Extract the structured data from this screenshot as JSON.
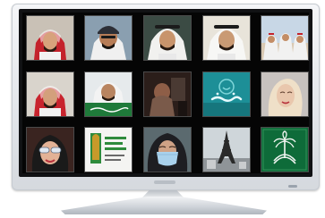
{
  "tiles": [
    {
      "id": "r1c1",
      "icon": "portrait-man-red-shemagh-icon",
      "colors": {
        "bg": "#c9c1b6",
        "cloth": "#c4222c",
        "face": "#d7a27c"
      }
    },
    {
      "id": "r1c2",
      "icon": "portrait-man-dark-cap-icon",
      "colors": {
        "bg": "#8a9fb0",
        "cloth": "#2d2f36",
        "face": "#b77d57"
      }
    },
    {
      "id": "r1c3",
      "icon": "portrait-man-white-ghutra-icon",
      "colors": {
        "bg": "#3b4b44",
        "cloth": "#f1f1ef",
        "face": "#c8946c"
      }
    },
    {
      "id": "r1c4",
      "icon": "portrait-man-white-ghutra-icon",
      "colors": {
        "bg": "#e8e4da",
        "cloth": "#f7f7f5",
        "face": "#c99a74"
      }
    },
    {
      "id": "r1c5",
      "icon": "group-photo-icon",
      "colors": {
        "bg": "#c8d7e6",
        "cloth": "#f1f1f1",
        "face": "#c38d66"
      }
    },
    {
      "id": "r2c1",
      "icon": "portrait-man-red-shemagh-icon",
      "colors": {
        "bg": "#d9d4cc",
        "cloth": "#c8242e",
        "face": "#d3a07c"
      }
    },
    {
      "id": "r2c2",
      "icon": "portrait-man-green-banner-icon",
      "colors": {
        "bg": "#e6eaec",
        "cloth": "#f3f3f3",
        "face": "#b88460",
        "accent": "#1f7a3a"
      }
    },
    {
      "id": "r2c3",
      "icon": "dark-scene-icon",
      "colors": {
        "bg": "#2b1e1a",
        "cloth": "#7a5a4a",
        "face": "#a06a50"
      }
    },
    {
      "id": "r2c4",
      "icon": "ibtisam-logo-icon",
      "colors": {
        "bg": "#1d8f97",
        "cloth": "#e7fbff",
        "face": "#7fd7da"
      }
    },
    {
      "id": "r2c5",
      "icon": "portrait-woman-blonde-icon",
      "colors": {
        "bg": "#c7c2bf",
        "cloth": "#efe0c8",
        "face": "#e9c7ad"
      }
    },
    {
      "id": "r3c1",
      "icon": "portrait-woman-sunglasses-icon",
      "colors": {
        "bg": "#3a2420",
        "cloth": "#1a1a1a",
        "face": "#e3b296",
        "accent": "#e0e8f2"
      }
    },
    {
      "id": "r3c2",
      "icon": "saudi-journalists-association-logo-icon",
      "colors": {
        "bg": "#f4f4f2",
        "cloth": "#2e8b3c",
        "face": "#c79a2a"
      }
    },
    {
      "id": "r3c3",
      "icon": "portrait-woman-face-mask-icon",
      "colors": {
        "bg": "#5b6a6f",
        "cloth": "#1e1e22",
        "face": "#cfa286",
        "accent": "#a9d1ec"
      }
    },
    {
      "id": "r3c4",
      "icon": "eiffel-tower-photo-icon",
      "colors": {
        "bg": "#cfd6da",
        "cloth": "#2a2a2a",
        "face": "#f2f2f2"
      }
    },
    {
      "id": "r3c5",
      "icon": "saudi-emblem-icon",
      "colors": {
        "bg": "#0e6b39",
        "cloth": "#f2f5f2",
        "face": "#0a5a2f"
      }
    }
  ]
}
